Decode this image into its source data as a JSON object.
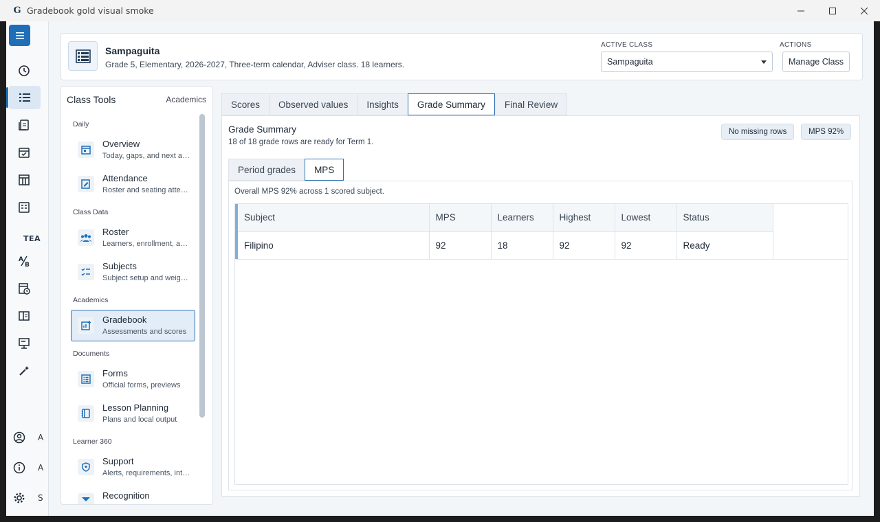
{
  "window": {
    "title": "Gradebook gold visual smoke",
    "logo_glyph": "G"
  },
  "rail": {
    "section_label": "TEA",
    "cut_a1": "A",
    "cut_a2": "A",
    "cut_s": "S"
  },
  "header": {
    "class_name": "Sampaguita",
    "class_desc": "Grade 5, Elementary, 2026-2027, Three-term calendar, Adviser class. 18 learners.",
    "active_class_label": "ACTIVE CLASS",
    "active_class_value": "Sampaguita",
    "actions_label": "ACTIONS",
    "manage_button": "Manage Class"
  },
  "tools": {
    "title": "Class Tools",
    "context": "Academics",
    "groups": {
      "daily": "Daily",
      "class_data": "Class Data",
      "academics": "Academics",
      "documents": "Documents",
      "learner360": "Learner 360"
    },
    "items": [
      {
        "title": "Overview",
        "sub": "Today, gaps, and next actions"
      },
      {
        "title": "Attendance",
        "sub": "Roster and seating attendance"
      },
      {
        "title": "Roster",
        "sub": "Learners, enrollment, and records"
      },
      {
        "title": "Subjects",
        "sub": "Subject setup and weights"
      },
      {
        "title": "Gradebook",
        "sub": "Assessments and scores"
      },
      {
        "title": "Forms",
        "sub": "Official forms, previews"
      },
      {
        "title": "Lesson Planning",
        "sub": "Plans and local output"
      },
      {
        "title": "Support",
        "sub": "Alerts, requirements, interventions"
      },
      {
        "title": "Recognition",
        "sub": ""
      }
    ]
  },
  "tabs": [
    "Scores",
    "Observed values",
    "Insights",
    "Grade Summary",
    "Final Review"
  ],
  "grade_summary": {
    "title": "Grade Summary",
    "subtitle": "18 of 18 grade rows are ready for Term 1.",
    "chip_missing": "No missing rows",
    "chip_mps": "MPS 92%",
    "sub_tabs": [
      "Period grades",
      "MPS"
    ],
    "mps_summary": "Overall MPS 92% across 1 scored subject.",
    "columns": [
      "Subject",
      "MPS",
      "Learners",
      "Highest",
      "Lowest",
      "Status"
    ],
    "rows": [
      [
        "Filipino",
        "92",
        "18",
        "92",
        "92",
        "Ready"
      ]
    ]
  },
  "colors": {
    "accent": "#1e6fb8",
    "selected_border": "#2d6fb1",
    "row_marker": "#7fb0dc"
  }
}
